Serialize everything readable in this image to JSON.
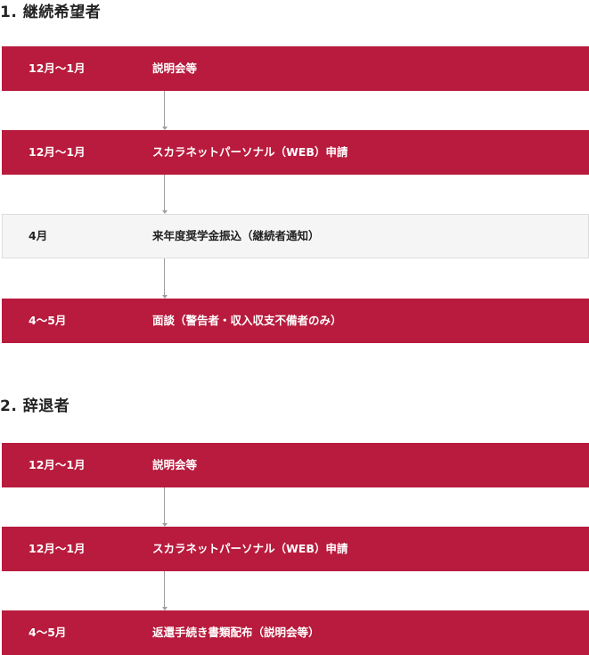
{
  "sections": [
    {
      "heading": "1. 継続希望者",
      "steps": [
        {
          "period": "12月〜1月",
          "description": "説明会等"
        },
        {
          "period": "12月〜1月",
          "description": "スカラネットパーソナル（WEB）申請"
        },
        {
          "period": "4月",
          "description": "来年度奨学金振込（継続者通知）"
        },
        {
          "period": "4〜5月",
          "description": "面談（警告者・収入収支不備者のみ）"
        }
      ]
    },
    {
      "heading": "2. 辞退者",
      "steps": [
        {
          "period": "12月〜1月",
          "description": "説明会等"
        },
        {
          "period": "12月〜1月",
          "description": "スカラネットパーソナル（WEB）申請"
        },
        {
          "period": "4〜5月",
          "description": "返還手続き書類配布（説明会等）"
        }
      ]
    }
  ],
  "colors": {
    "step_red": "#b81b3d",
    "step_grey": "#f5f5f5",
    "connector": "#9e9e9e"
  }
}
